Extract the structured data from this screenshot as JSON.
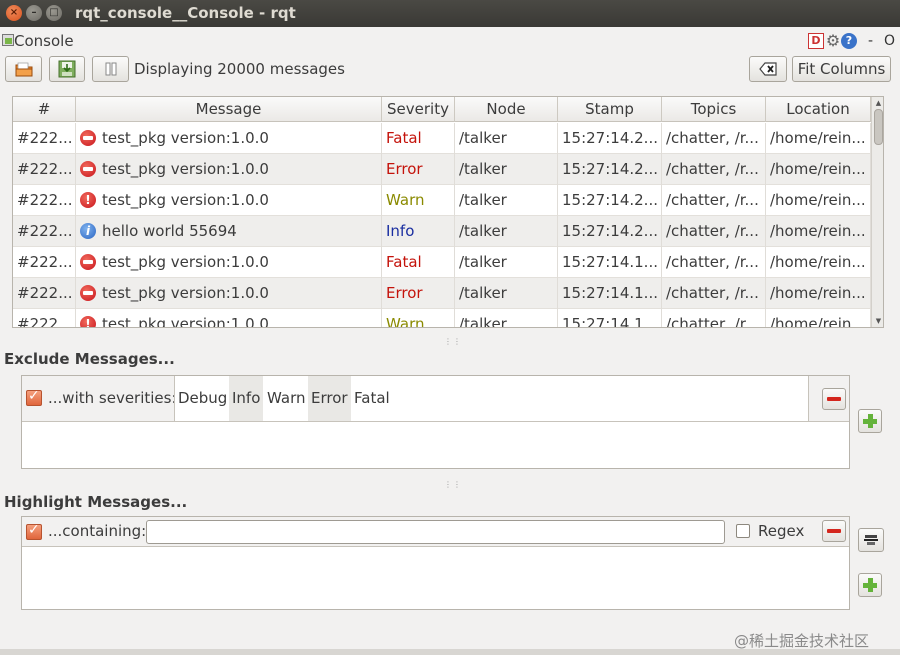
{
  "window": {
    "title": "rqt_console__Console - rqt",
    "close_glyph": "×",
    "min_glyph": "–",
    "max_glyph": "□"
  },
  "dock": {
    "title": "Console",
    "d_label": "D",
    "help_label": "?",
    "minimize_label": "-",
    "float_label": "O"
  },
  "toolbar": {
    "status": "Displaying 20000 messages",
    "fit_columns_label": "Fit Columns"
  },
  "table": {
    "headers": [
      "#",
      "Message",
      "Severity",
      "Node",
      "Stamp",
      "Topics",
      "Location"
    ],
    "rows": [
      {
        "num": "#222...",
        "icon": "fatal",
        "message": "test_pkg version:1.0.0",
        "severity": "Fatal",
        "node": "/talker",
        "stamp": "15:27:14.2...",
        "topics": "/chatter, /r...",
        "location": "/home/rein..."
      },
      {
        "num": "#222...",
        "icon": "error",
        "message": "test_pkg version:1.0.0",
        "severity": "Error",
        "node": "/talker",
        "stamp": "15:27:14.2...",
        "topics": "/chatter, /r...",
        "location": "/home/rein..."
      },
      {
        "num": "#222...",
        "icon": "warn",
        "message": "test_pkg version:1.0.0",
        "severity": "Warn",
        "node": "/talker",
        "stamp": "15:27:14.2...",
        "topics": "/chatter, /r...",
        "location": "/home/rein..."
      },
      {
        "num": "#222...",
        "icon": "info",
        "message": "hello world 55694",
        "severity": "Info",
        "node": "/talker",
        "stamp": "15:27:14.2...",
        "topics": "/chatter, /r...",
        "location": "/home/rein..."
      },
      {
        "num": "#222...",
        "icon": "fatal",
        "message": "test_pkg version:1.0.0",
        "severity": "Fatal",
        "node": "/talker",
        "stamp": "15:27:14.1...",
        "topics": "/chatter, /r...",
        "location": "/home/rein..."
      },
      {
        "num": "#222...",
        "icon": "error",
        "message": "test_pkg version:1.0.0",
        "severity": "Error",
        "node": "/talker",
        "stamp": "15:27:14.1...",
        "topics": "/chatter, /r...",
        "location": "/home/rein..."
      },
      {
        "num": "#222...",
        "icon": "warn",
        "message": "test_pkg version:1.0.0",
        "severity": "Warn",
        "node": "/talker",
        "stamp": "15:27:14.1...",
        "topics": "/chatter, /r...",
        "location": "/home/rein..."
      }
    ]
  },
  "exclude": {
    "title": "Exclude Messages...",
    "filter_label": "...with severities:",
    "severities": [
      {
        "label": "Debug",
        "selected": false
      },
      {
        "label": "Info",
        "selected": true
      },
      {
        "label": "Warn",
        "selected": false
      },
      {
        "label": "Error",
        "selected": true
      },
      {
        "label": "Fatal",
        "selected": false
      }
    ]
  },
  "highlight": {
    "title": "Highlight Messages...",
    "filter_label": "...containing:",
    "text_value": "",
    "regex_label": "Regex"
  },
  "watermark": "@稀土掘金技术社区",
  "colors": {
    "fatal": "#c4130b",
    "error": "#c4130b",
    "warn": "#8a8a00",
    "info": "#1a2ea0",
    "accent": "#e0663c"
  }
}
